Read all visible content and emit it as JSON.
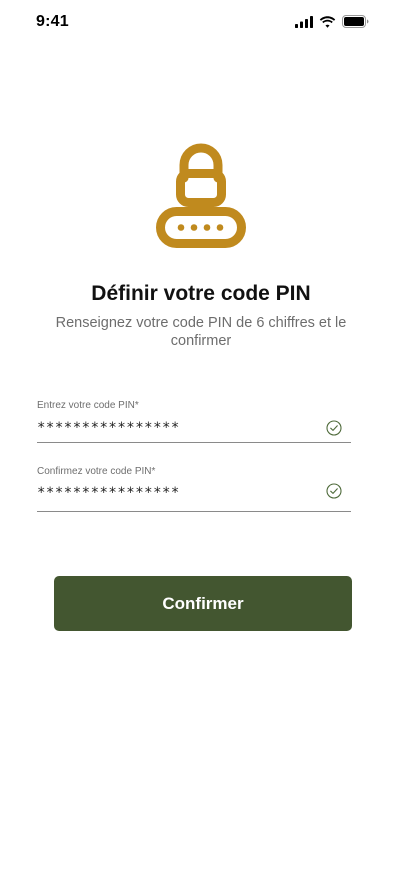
{
  "status_bar": {
    "time": "9:41"
  },
  "icons": {
    "hero": "lock-icon",
    "signal": "cellular-signal-icon",
    "wifi": "wifi-icon",
    "battery": "battery-icon",
    "valid": "check-circle-icon"
  },
  "header": {
    "title": "Définir votre code PIN",
    "subtitle": "Renseignez votre code PIN de 6 chiffres et le confirmer"
  },
  "form": {
    "pin": {
      "label": "Entrez votre code PIN*",
      "value": "****************",
      "valid": true
    },
    "pin_confirm": {
      "label": "Confirmez votre code PIN*",
      "value": "****************",
      "valid": true
    },
    "submit_label": "Confirmer"
  },
  "colors": {
    "accent": "#C08A1E",
    "button": "#435630",
    "valid": "#4E6A3A"
  }
}
